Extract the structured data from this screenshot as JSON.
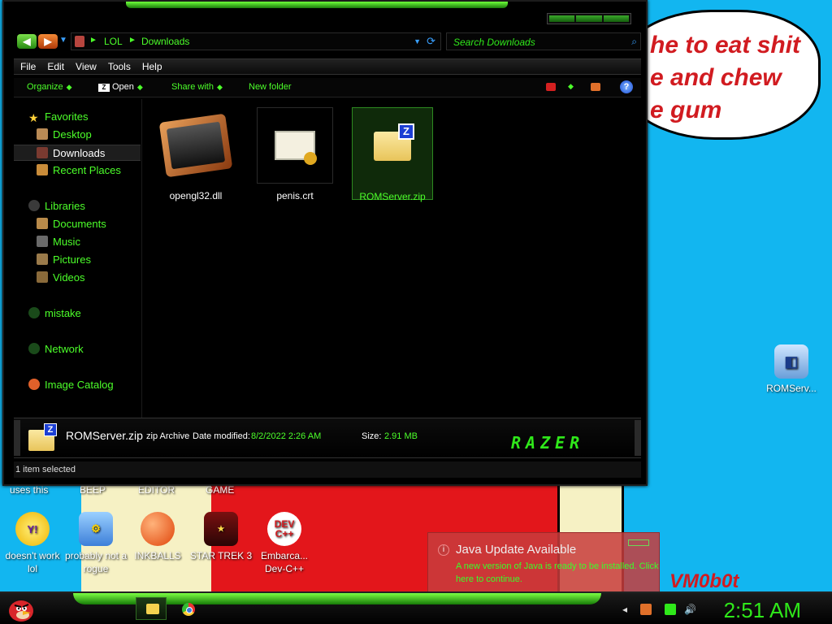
{
  "wallpaper": {
    "bubble_lines": [
      "he to eat shit",
      "e and chew",
      "e gum"
    ],
    "signature": "VM0b0t"
  },
  "explorer": {
    "address": {
      "crumbs": [
        "LOL",
        "Downloads"
      ],
      "separator": "►"
    },
    "search_placeholder": "Search Downloads",
    "menu": [
      "File",
      "Edit",
      "View",
      "Tools",
      "Help"
    ],
    "commands": {
      "organize": "Organize",
      "open": "Open",
      "share_with": "Share with",
      "new_folder": "New folder",
      "help": "?"
    },
    "nav": {
      "favorites": "Favorites",
      "desktop": "Desktop",
      "downloads": "Downloads",
      "recent_places": "Recent Places",
      "libraries": "Libraries",
      "documents": "Documents",
      "music": "Music",
      "pictures": "Pictures",
      "videos": "Videos",
      "homegroup": "mistake",
      "network": "Network",
      "image_catalog": "Image Catalog"
    },
    "files": [
      {
        "name": "opengl32.dll"
      },
      {
        "name": "penis.crt"
      },
      {
        "name": "ROMServer.zip"
      }
    ],
    "details": {
      "name": "ROMServer.zip",
      "type": "zip Archive",
      "modified_label": "Date modified:",
      "modified": "8/2/2022 2:26 AM",
      "size_label": "Size:",
      "size": "2.91 MB",
      "brand": "RAZER"
    },
    "status": "1 item selected"
  },
  "desktop_icons": {
    "top_labels": [
      "uses this",
      "BEEP",
      "EDITOR",
      "GAME"
    ],
    "icons": [
      {
        "label": "doesn't work lol"
      },
      {
        "label": "probably not a rogue"
      },
      {
        "label": "INKBALLS"
      },
      {
        "label": "STAR TREK 3"
      },
      {
        "label": "Embarca... Dev-C++"
      },
      {
        "label": "ROMServ..."
      }
    ],
    "devcpp_icon_text": "DEV C++"
  },
  "java_notification": {
    "title": "Java Update Available",
    "message": "A new version of Java is ready to be installed. Click here to continue."
  },
  "taskbar": {
    "clock": "2:51 AM"
  },
  "colors": {
    "accent_green": "#4cff2a",
    "wallpaper_blue": "#12b6f0",
    "wallpaper_red": "#e3161b"
  }
}
